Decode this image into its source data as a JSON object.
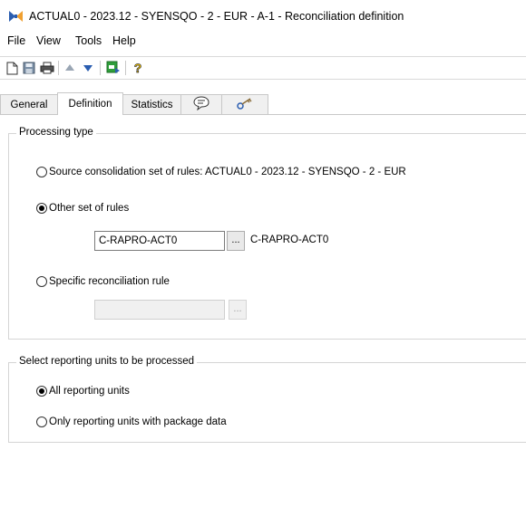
{
  "window": {
    "title": "ACTUAL0 - 2023.12 - SYENSQO - 2 - EUR - A-1 - Reconciliation definition",
    "icon": "bowtie-app-icon"
  },
  "menu": [
    "File",
    "View",
    "Tools",
    "Help"
  ],
  "toolbar": {
    "buttons": [
      "new-document-icon",
      "save-icon",
      "print-icon",
      "arrow-up-icon",
      "arrow-down-icon",
      "run-icon",
      "help-icon"
    ]
  },
  "tabs": [
    {
      "label": "General",
      "active": false
    },
    {
      "label": "Definition",
      "active": true
    },
    {
      "label": "Statistics",
      "active": false
    },
    {
      "label": "",
      "icon": "comment-bubble-icon"
    },
    {
      "label": "",
      "icon": "key-icon"
    }
  ],
  "processing": {
    "legend": "Processing type",
    "source_label": "Source consolidation set of rules: ACTUAL0 - 2023.12 - SYENSQO - 2 - EUR",
    "other_label": "Other set of rules",
    "other_value": "C-RAPRO-ACT0",
    "browse_label": "...",
    "other_desc": "C-RAPRO-ACT0",
    "specific_label": "Specific reconciliation rule",
    "specific_value": "",
    "specific_browse_label": "...",
    "selected": "other"
  },
  "reporting": {
    "legend": "Select reporting units to be processed",
    "all_label": "All reporting units",
    "only_label": "Only reporting units with package data",
    "selected": "all"
  },
  "colors": {
    "accent_blue": "#2a5db0",
    "icon_green": "#2e9e3a",
    "help_yellow": "#f2c300"
  }
}
